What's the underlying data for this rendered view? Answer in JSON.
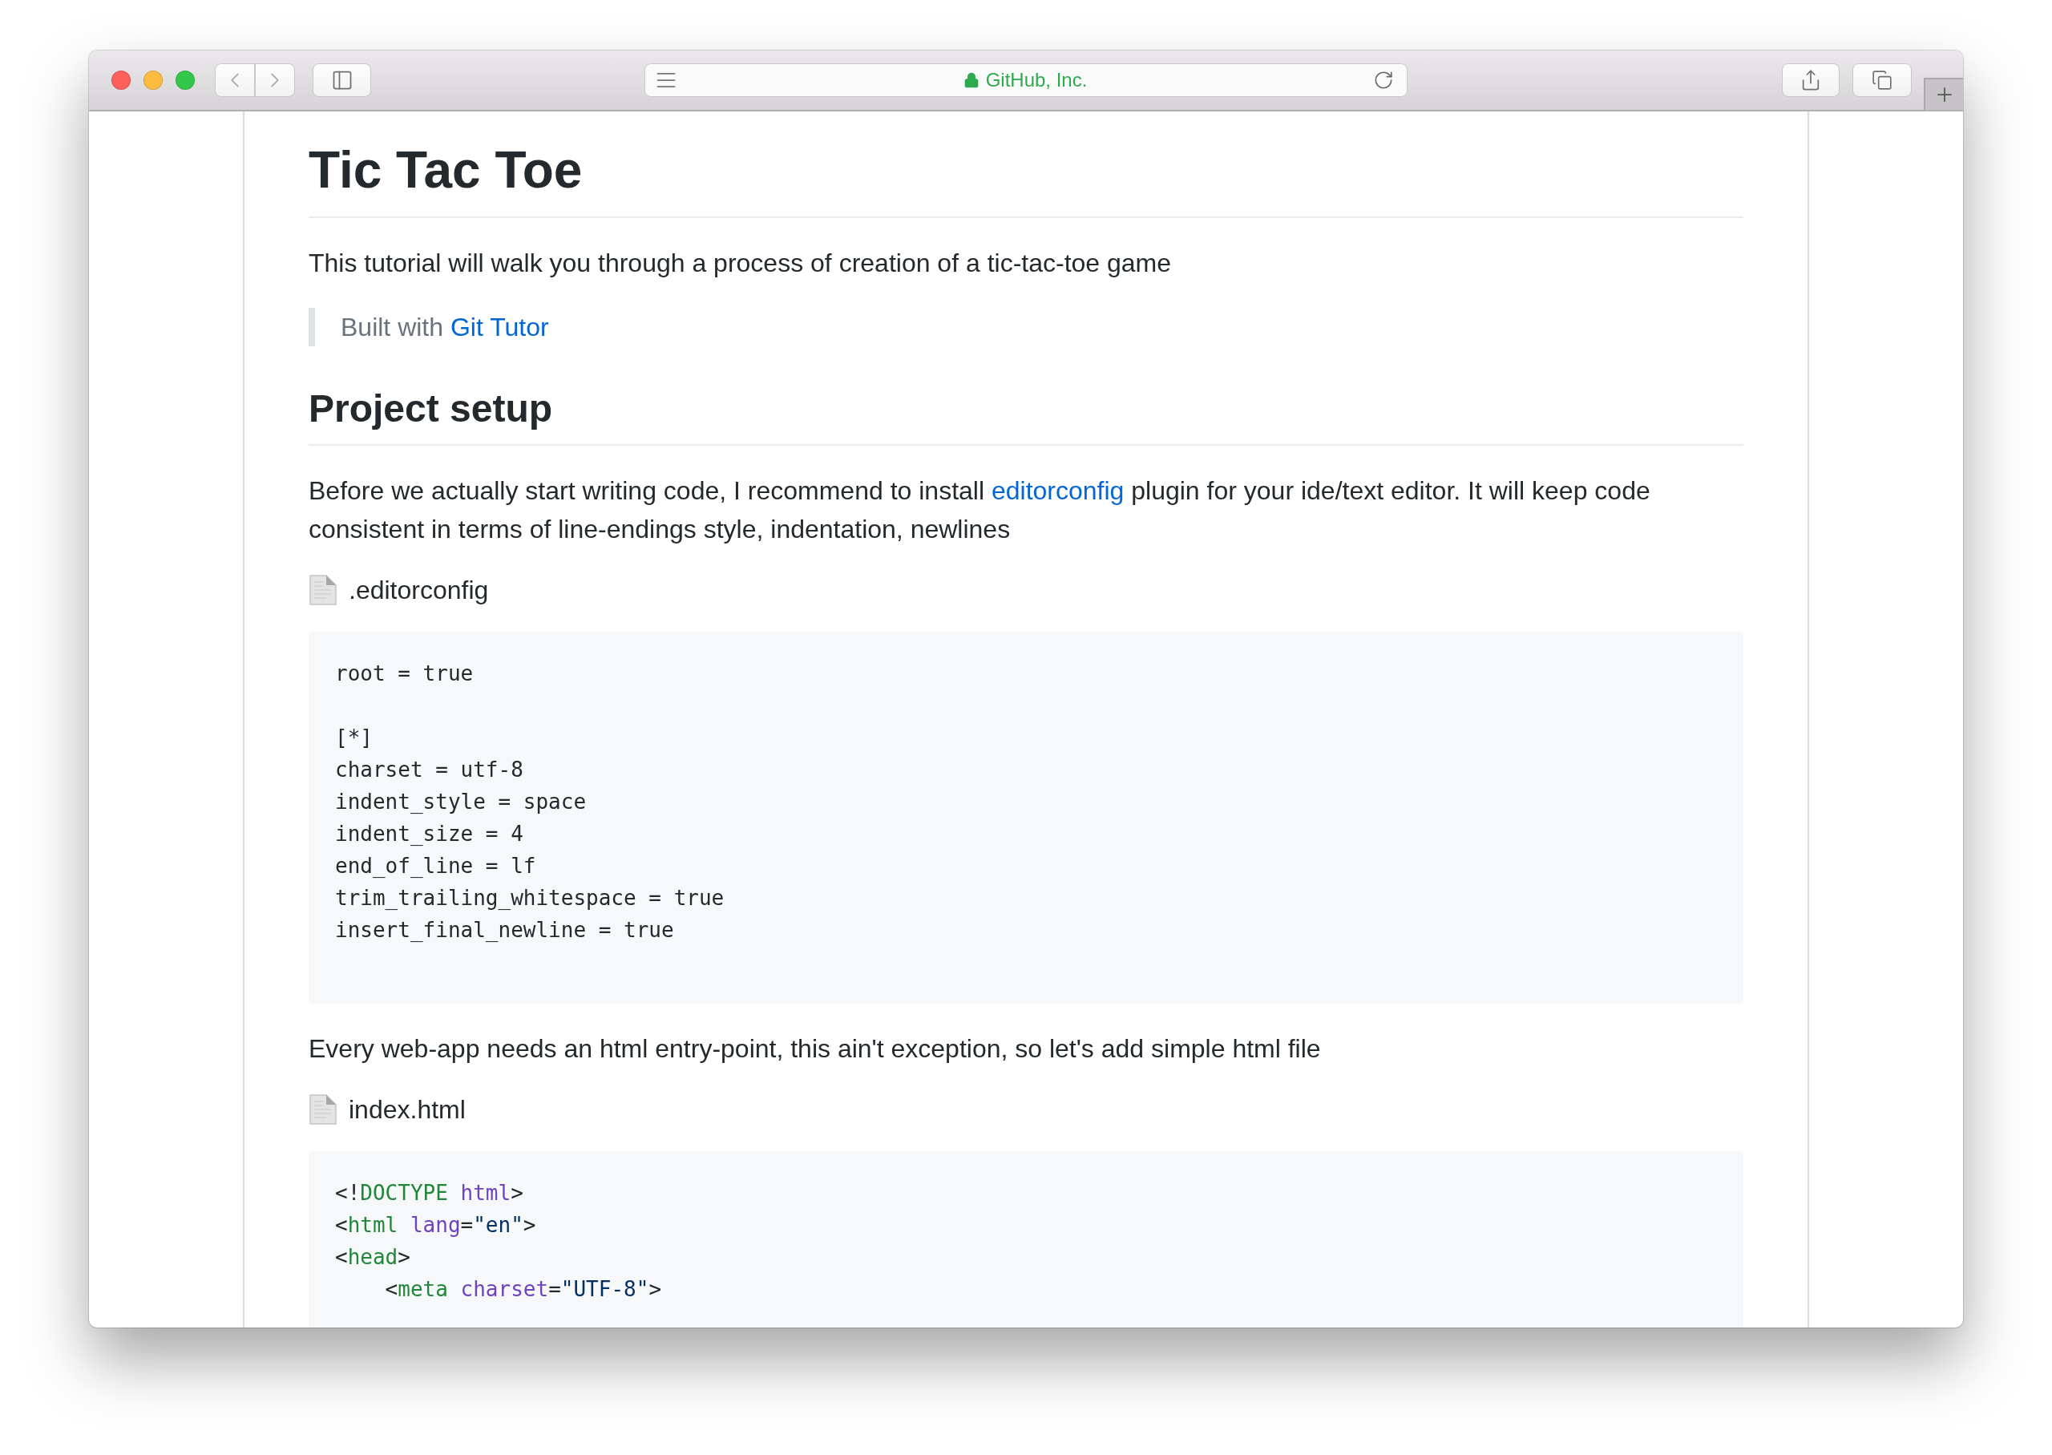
{
  "browser": {
    "address": "GitHub, Inc.",
    "secure": true
  },
  "article": [
    {
      "kind": "h1",
      "text": "Tic Tac Toe"
    },
    {
      "kind": "p",
      "parts": [
        {
          "text": "This tutorial will walk you through a process of creation of a tic-tac-toe game"
        }
      ]
    },
    {
      "kind": "quote",
      "parts": [
        {
          "text": "Built with "
        },
        {
          "text": "Git Tutor",
          "link": true
        }
      ]
    },
    {
      "kind": "h2",
      "text": "Project setup"
    },
    {
      "kind": "p",
      "parts": [
        {
          "text": "Before we actually start writing code, I recommend to install "
        },
        {
          "text": "editorconfig",
          "link": true
        },
        {
          "text": " plugin for your ide/text editor. It will keep code consistent in terms of line-endings style, indentation, newlines"
        }
      ]
    },
    {
      "kind": "file",
      "text": ".editorconfig"
    },
    {
      "kind": "code",
      "text": "root = true\n\n[*]\ncharset = utf-8\nindent_style = space\nindent_size = 4\nend_of_line = lf\ntrim_trailing_whitespace = true\ninsert_final_newline = true"
    },
    {
      "kind": "p",
      "parts": [
        {
          "text": "Every web-app needs an html entry-point, this ain't exception, so let's add simple html file"
        }
      ]
    },
    {
      "kind": "file",
      "text": "index.html"
    },
    {
      "kind": "highlighted",
      "lines": [
        [
          {
            "text": "<!",
            "kind": "plain"
          },
          {
            "text": "DOCTYPE",
            "kind": "tag"
          },
          {
            "text": " html",
            "kind": "attr"
          },
          {
            "text": ">",
            "kind": "plain"
          }
        ],
        [
          {
            "text": "<",
            "kind": "plain"
          },
          {
            "text": "html",
            "kind": "tag"
          },
          {
            "text": " lang",
            "kind": "attr"
          },
          {
            "text": "=",
            "kind": "plain"
          },
          {
            "text": "\"en\"",
            "kind": "string"
          },
          {
            "text": ">",
            "kind": "plain"
          }
        ],
        [
          {
            "text": "<",
            "kind": "plain"
          },
          {
            "text": "head",
            "kind": "tag"
          },
          {
            "text": ">",
            "kind": "plain"
          }
        ],
        [
          {
            "text": "    <",
            "kind": "plain"
          },
          {
            "text": "meta",
            "kind": "tag"
          },
          {
            "text": " charset",
            "kind": "attr"
          },
          {
            "text": "=",
            "kind": "plain"
          },
          {
            "text": "\"UTF-8\"",
            "kind": "string"
          },
          {
            "text": ">",
            "kind": "plain"
          }
        ]
      ]
    }
  ]
}
